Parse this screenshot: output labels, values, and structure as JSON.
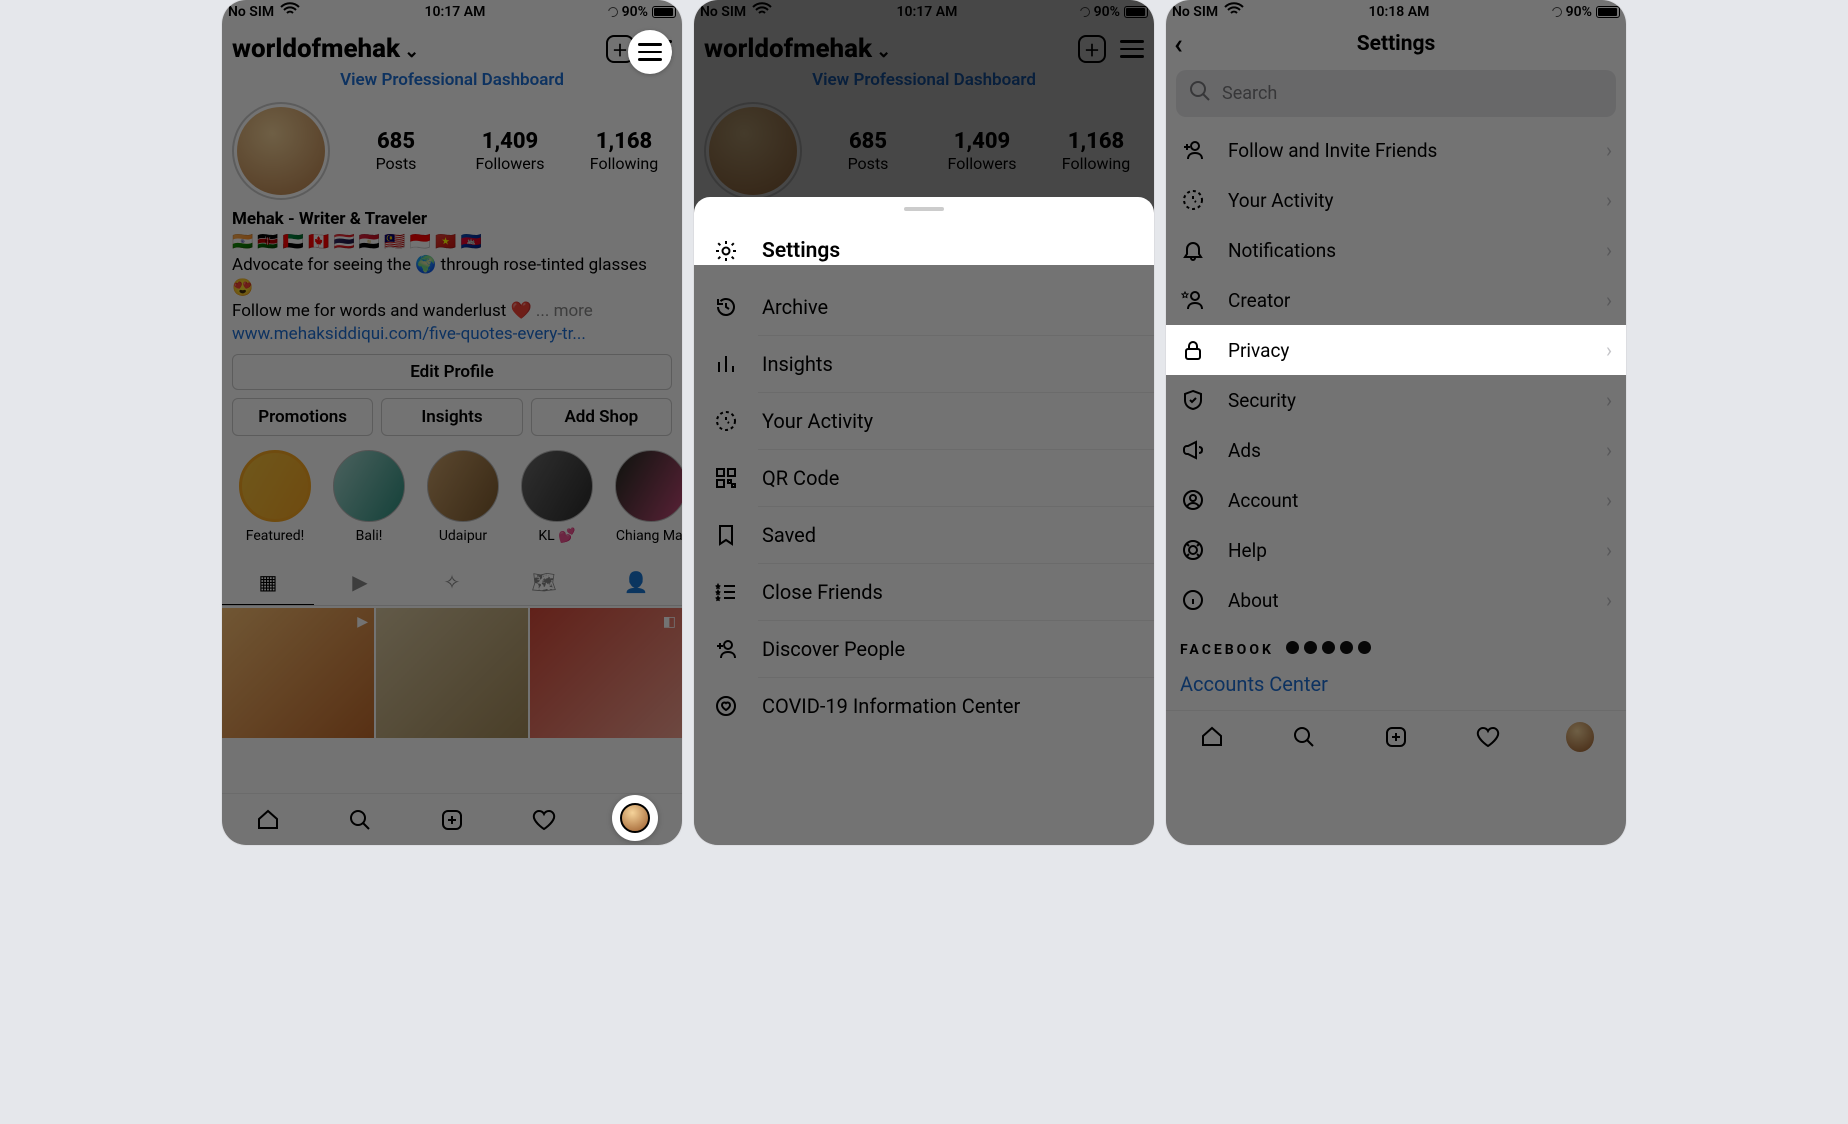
{
  "status": {
    "carrier": "No SIM",
    "time_a": "10:17 AM",
    "time_b": "10:17 AM",
    "time_c": "10:18 AM",
    "battery": "90%"
  },
  "profile": {
    "username": "worldofmehak",
    "dashboard_link": "View Professional Dashboard",
    "stats": {
      "posts": "685",
      "followers": "1,409",
      "following": "1,168",
      "posts_lbl": "Posts",
      "followers_lbl": "Followers",
      "following_lbl": "Following"
    },
    "name": "Mehak - Writer & Traveler",
    "flags": "🇮🇳 🇰🇪 🇦🇪 🇨🇦 🇹🇭 🇪🇬 🇲🇾 🇮🇩 🇻🇳 🇰🇭",
    "bio1": "Advocate for seeing the 🌍 through rose-tinted glasses 😍",
    "bio2_pre": "Follow me for words and wanderlust ❤️ ",
    "more": "... more",
    "url": "www.mehaksiddiqui.com/five-quotes-every-tr...",
    "edit_btn": "Edit Profile",
    "actions": {
      "promotions": "Promotions",
      "insights": "Insights",
      "addshop": "Add Shop"
    },
    "highlights": [
      {
        "label": "Featured!"
      },
      {
        "label": "Bali!"
      },
      {
        "label": "Udaipur"
      },
      {
        "label": "KL 💕"
      },
      {
        "label": "Chiang Mai"
      }
    ]
  },
  "sheet": {
    "items": [
      {
        "icon": "settings-gear",
        "label": "Settings",
        "highlighted": true
      },
      {
        "icon": "history",
        "label": "Archive"
      },
      {
        "icon": "bar-chart",
        "label": "Insights"
      },
      {
        "icon": "activity",
        "label": "Your Activity"
      },
      {
        "icon": "qr",
        "label": "QR Code"
      },
      {
        "icon": "bookmark",
        "label": "Saved"
      },
      {
        "icon": "star-list",
        "label": "Close Friends"
      },
      {
        "icon": "person-plus",
        "label": "Discover People"
      },
      {
        "icon": "heart-circle",
        "label": "COVID-19 Information Center"
      }
    ]
  },
  "settings": {
    "title": "Settings",
    "search_placeholder": "Search",
    "rows": [
      {
        "icon": "person-plus",
        "label": "Follow and Invite Friends"
      },
      {
        "icon": "activity",
        "label": "Your Activity"
      },
      {
        "icon": "bell",
        "label": "Notifications"
      },
      {
        "icon": "star-person",
        "label": "Creator"
      },
      {
        "icon": "lock",
        "label": "Privacy",
        "highlighted": true
      },
      {
        "icon": "shield",
        "label": "Security"
      },
      {
        "icon": "megaphone",
        "label": "Ads"
      },
      {
        "icon": "account-circle",
        "label": "Account"
      },
      {
        "icon": "life-ring",
        "label": "Help"
      },
      {
        "icon": "info",
        "label": "About"
      }
    ],
    "facebook_label": "FACEBOOK",
    "accounts_center": "Accounts Center"
  }
}
